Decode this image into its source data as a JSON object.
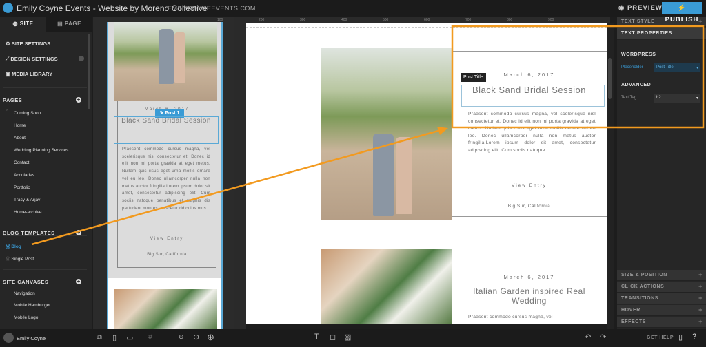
{
  "header": {
    "title": "Emily Coyne Events - Website by Moreno Collective",
    "domain": "EMILYCOYNEEVENTS.COM",
    "preview": "PREVIEW",
    "publish": "PUBLISH"
  },
  "sidebar": {
    "tabs": [
      "SITE",
      "PAGE"
    ],
    "settings": [
      "SITE SETTINGS",
      "DESIGN SETTINGS",
      "MEDIA LIBRARY"
    ],
    "pages_heading": "PAGES",
    "pages": [
      "Coming Soon",
      "Home",
      "About",
      "Wedding Planning Services",
      "Contact",
      "Accolades",
      "Portfolio",
      "Tracy & Arjav",
      "Home-archive"
    ],
    "blog_heading": "BLOG TEMPLATES",
    "blog": [
      "Blog",
      "Single Post"
    ],
    "blog_more": "···",
    "canvases_heading": "SITE CANVASES",
    "canvases": [
      "Navigation",
      "Mobile Hamburger",
      "Mobile Logo"
    ]
  },
  "user": {
    "name": "Emily Coyne"
  },
  "ruler": [
    "100",
    "200",
    "300",
    "400",
    "500",
    "600",
    "700",
    "800",
    "900"
  ],
  "mobile": {
    "badge": "Post 1",
    "date": "March 6, 2017",
    "title": "Black Sand Bridal Session",
    "body": "Praesent commodo cursus magna, vel scelerisque nisl consectetur et. Donec id elit non mi porta gravida at eget metus. Nullam quis risus eget urna mollis ornare vel eu leo. Donec ullamcorper nulla non metus auctor fringilla.Lorem ipsum dolor sit amet, consectetur adipiscing elit. Cum sociis natoque penatibus et magnis dis parturient montes, nascetur ridiculus mus...",
    "view": "View Entry",
    "location": "Big Sur, California"
  },
  "main": {
    "tooltip": "Post Title",
    "posts": [
      {
        "date": "March 6, 2017",
        "title": "Black Sand Bridal Session",
        "body": "Praesent commodo cursus magna, vel scelerisque nisl consectetur et. Donec id elit non mi porta gravida at eget metus. Nullam quis risus eget urna mollis ornare vel eu leo. Donec ullamcorper nulla non metus auctor fringilla.Lorem ipsum dolor sit amet, consectetur adipiscing elit. Cum sociis natoque",
        "view": "View Entry",
        "location": "Big Sur, California"
      },
      {
        "date": "March 6, 2017",
        "title": "Italian Garden inspired Real Wedding",
        "body": "Praesent commodo cursus magna, vel"
      }
    ]
  },
  "rpanel": {
    "text_style": "TEXT STYLE",
    "text_properties": "TEXT PROPERTIES",
    "wordpress": "WORDPRESS",
    "placeholder_label": "Placeholder",
    "placeholder_value": "Post Title",
    "advanced": "ADVANCED",
    "text_tag_label": "Text Tag",
    "text_tag_value": "h2",
    "sections": [
      "SIZE & POSITION",
      "CLICK ACTIONS",
      "TRANSITIONS",
      "HOVER",
      "EFFECTS"
    ]
  },
  "footer": {
    "help": "GET HELP"
  },
  "colors": {
    "accent": "#3a9bd5",
    "annotation": "#f29a1f"
  }
}
